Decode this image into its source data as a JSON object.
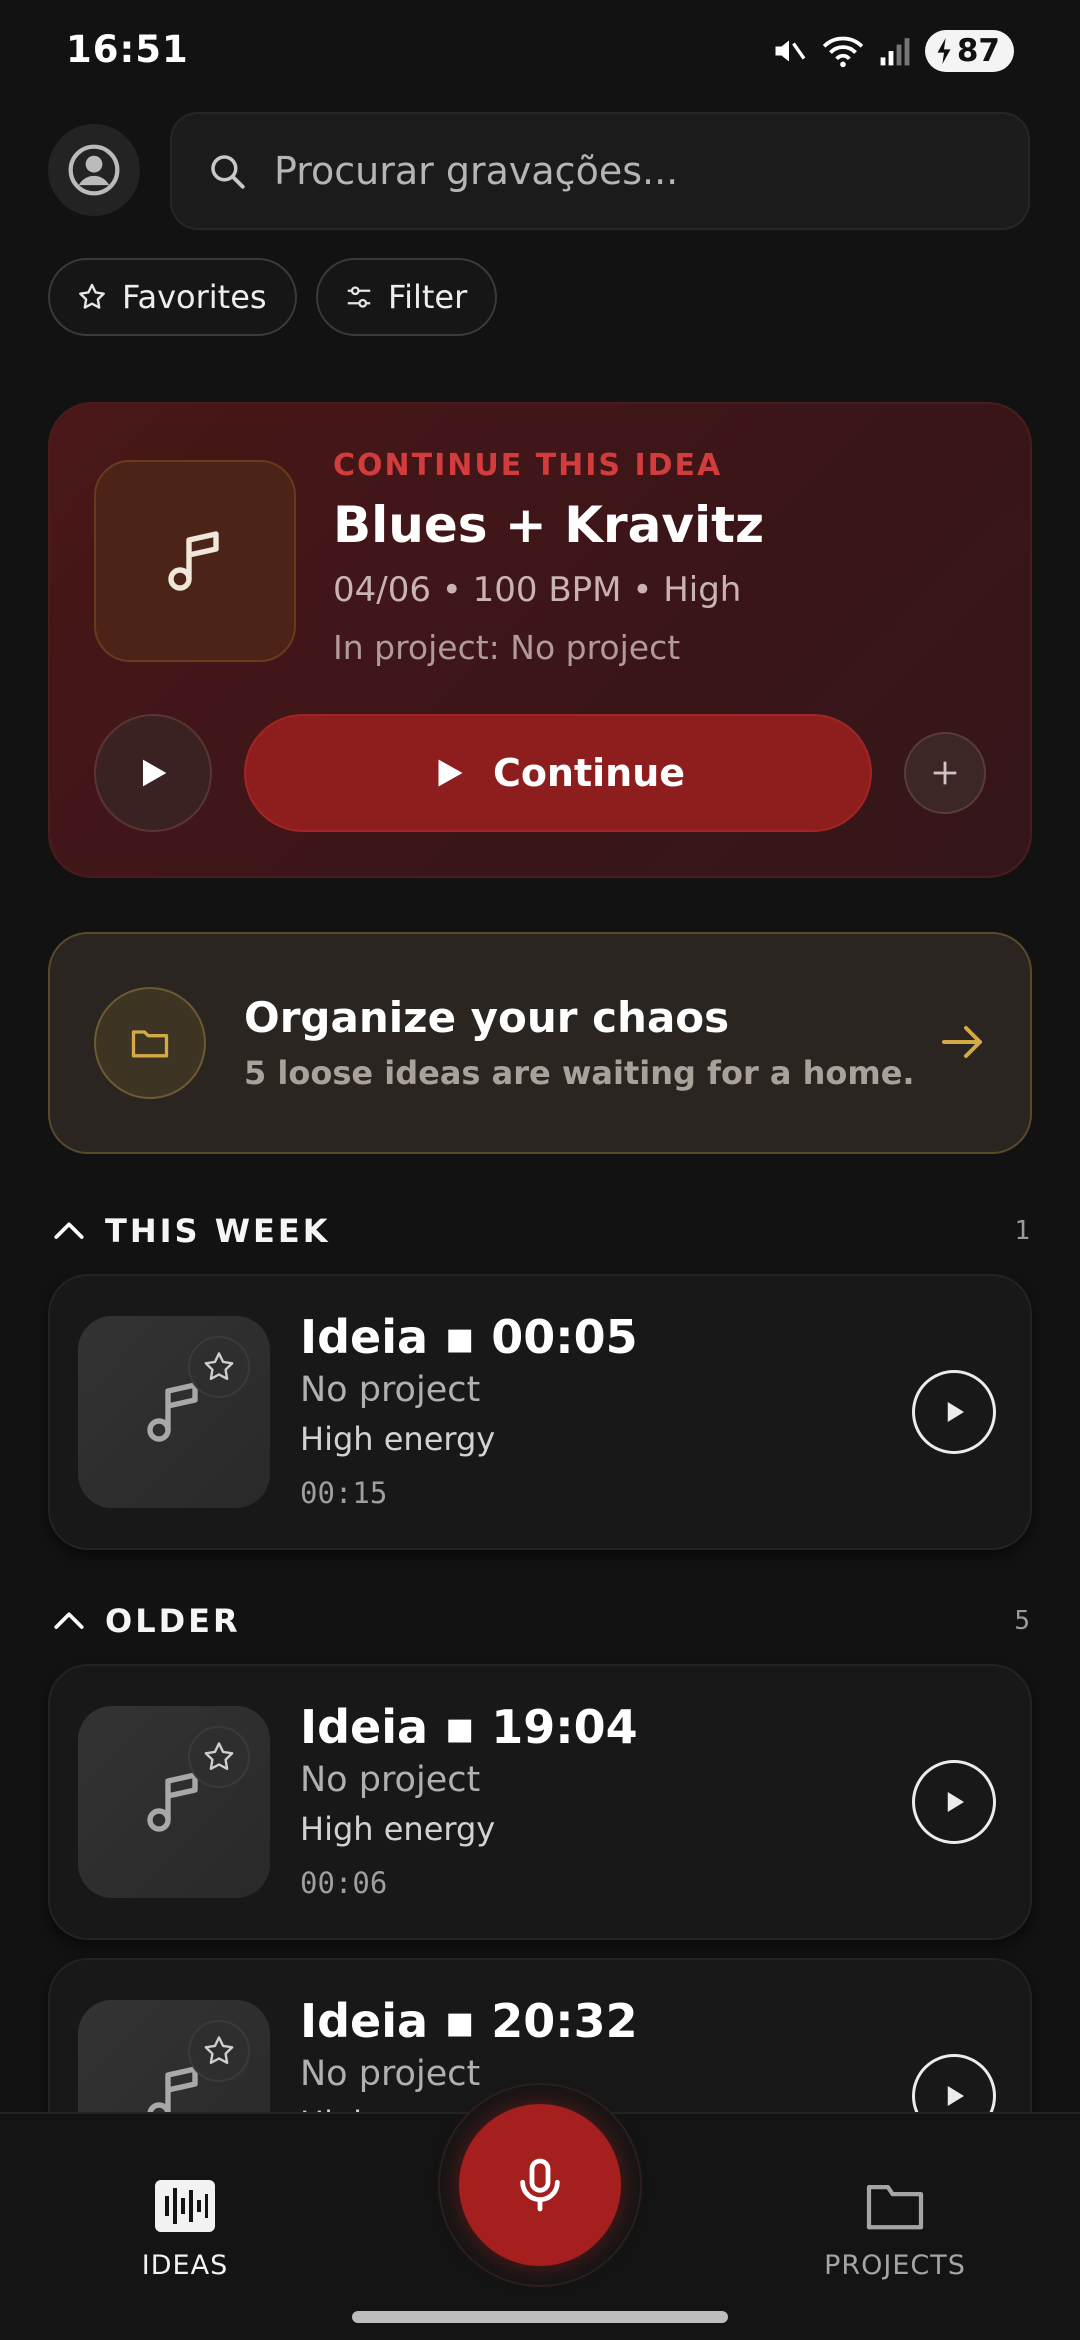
{
  "status_bar": {
    "time": "16:51",
    "battery": "87"
  },
  "search": {
    "placeholder": "Procurar gravações..."
  },
  "chips": {
    "favorites": "Favorites",
    "filter": "Filter"
  },
  "continue_card": {
    "eyebrow": "CONTINUE THIS IDEA",
    "title": "Blues + Kravitz",
    "meta": "04/06 • 100 BPM • High",
    "project": "In project: No project",
    "continue_label": "Continue"
  },
  "organize_card": {
    "title": "Organize your chaos",
    "subtitle": "5 loose ideas are waiting for a home."
  },
  "sections": [
    {
      "title": "THIS WEEK",
      "count": "1",
      "items": [
        {
          "title": "Ideia ▪ 00:05",
          "project": "No project",
          "energy": "High energy",
          "duration": "00:15"
        }
      ]
    },
    {
      "title": "OLDER",
      "count": "5",
      "items": [
        {
          "title": "Ideia ▪ 19:04",
          "project": "No project",
          "energy": "High energy",
          "duration": "00:06"
        },
        {
          "title": "Ideia ▪ 20:32",
          "project": "No project",
          "energy": "High energy",
          "duration": ""
        }
      ]
    }
  ],
  "bottom_nav": {
    "ideas": "IDEAS",
    "projects": "PROJECTS"
  },
  "colors": {
    "accent_red": "#a51f1f",
    "accent_gold": "#c8a04a",
    "background": "#121212"
  },
  "icons": [
    "mute-icon",
    "wifi-icon",
    "signal-icon",
    "battery-icon",
    "avatar-icon",
    "search-icon",
    "star-icon",
    "filter-icon",
    "music-note-icon",
    "play-icon",
    "plus-icon",
    "folder-icon",
    "arrow-right-icon",
    "chevron-up-icon",
    "waveform-icon",
    "microphone-icon"
  ]
}
